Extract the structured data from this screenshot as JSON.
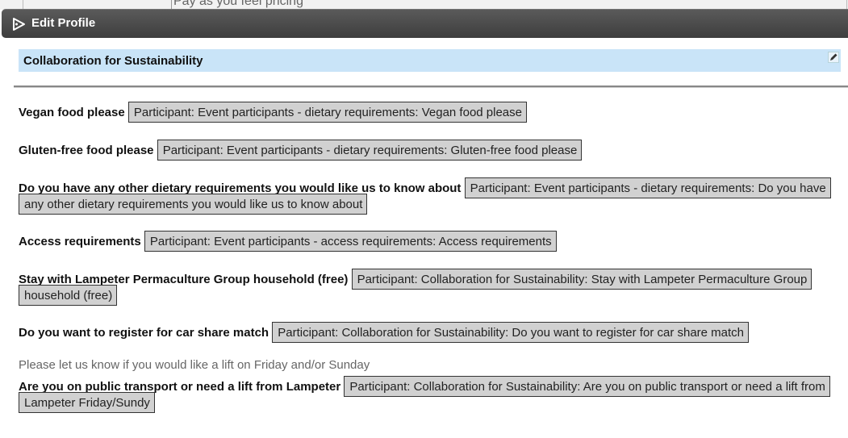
{
  "background": {
    "partial_text": "Pay as you feel pricing"
  },
  "dialog": {
    "title": "Edit Profile"
  },
  "section": {
    "title": "Collaboration for Sustainability"
  },
  "fields": [
    {
      "label": "Vegan food please",
      "value": "Participant: Event participants - dietary requirements: Vegan food please"
    },
    {
      "label": "Gluten-free food please",
      "value": "Participant: Event participants - dietary requirements: Gluten-free food please"
    },
    {
      "label": "Do you have any other dietary requirements you would like us to know about",
      "value": "Participant: Event participants - dietary requirements: Do you have any other dietary requirements you would like us to know about"
    },
    {
      "label": "Access requirements",
      "value": "Participant: Event participants - access requirements: Access requirements"
    },
    {
      "label": "Stay with Lampeter Permaculture Group household (free)",
      "value": "Participant: Collaboration for Sustainability: Stay with Lampeter Permaculture Group household (free)"
    },
    {
      "label": "Do you want to register for car share match",
      "value": "Participant: Collaboration for Sustainability: Do you want to register for car share match"
    },
    {
      "label": "Are you on public transport or need a lift from Lampeter",
      "value": "Participant: Collaboration for Sustainability: Are you on public transport or need a lift from Lampeter Friday/Sundy"
    }
  ],
  "hint": "Please let us know if you would like a lift on Friday and/or Sunday",
  "colors": {
    "titlebar": "#4a4a4a",
    "section_bg": "#c9e4f8",
    "value_bg": "#d1d1d1"
  },
  "icons": {
    "title": "tag-icon",
    "edit": "pencil-icon"
  }
}
